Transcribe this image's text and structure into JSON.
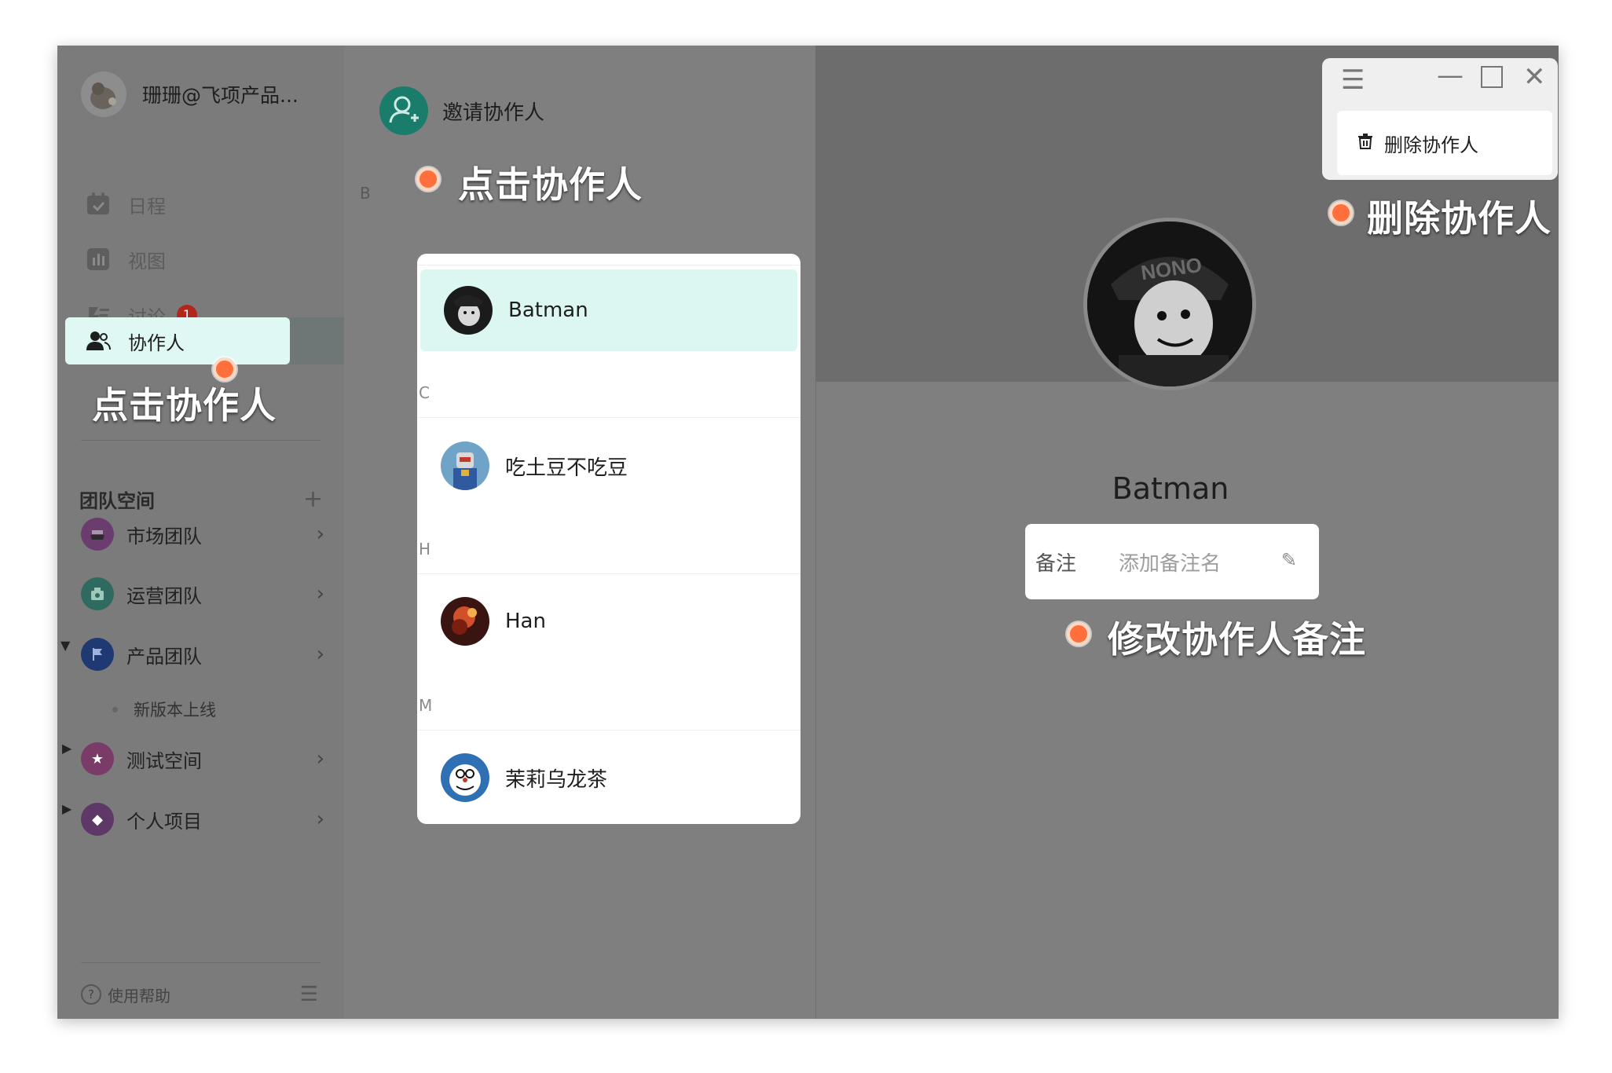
{
  "user": {
    "name": "珊珊@飞项产品..."
  },
  "nav": {
    "schedule": "日程",
    "view": "视图",
    "discussion": "讨论",
    "discussion_badge": "1",
    "collaborators": "协作人"
  },
  "team_section": {
    "title": "团队空间",
    "add": "+",
    "items": [
      {
        "label": "市场团队"
      },
      {
        "label": "运营团队"
      },
      {
        "label": "产品团队"
      },
      {
        "label": "新版本上线"
      },
      {
        "label": "测试空间"
      },
      {
        "label": "个人项目"
      }
    ]
  },
  "footer": {
    "help": "使用帮助"
  },
  "invite": {
    "label": "邀请协作人"
  },
  "contacts": {
    "groups": [
      {
        "letter": "B",
        "name": "Batman"
      },
      {
        "letter": "C",
        "name": "吃土豆不吃豆"
      },
      {
        "letter": "H",
        "name": "Han"
      },
      {
        "letter": "M",
        "name": "茉莉乌龙茶"
      }
    ]
  },
  "detail": {
    "name": "Batman",
    "remark_label": "备注",
    "remark_placeholder": "添加备注名"
  },
  "menu": {
    "delete": "删除协作人"
  },
  "annotations": {
    "click_collab_sidebar": "点击协作人",
    "click_collab_list": "点击协作人",
    "delete_collab": "删除协作人",
    "edit_remark": "修改协作人备注"
  },
  "colors": {
    "accent": "#1a7c6a",
    "selected": "#dcf7f2",
    "annotation_dot": "#ff6f3c",
    "badge": "#b3261e"
  }
}
